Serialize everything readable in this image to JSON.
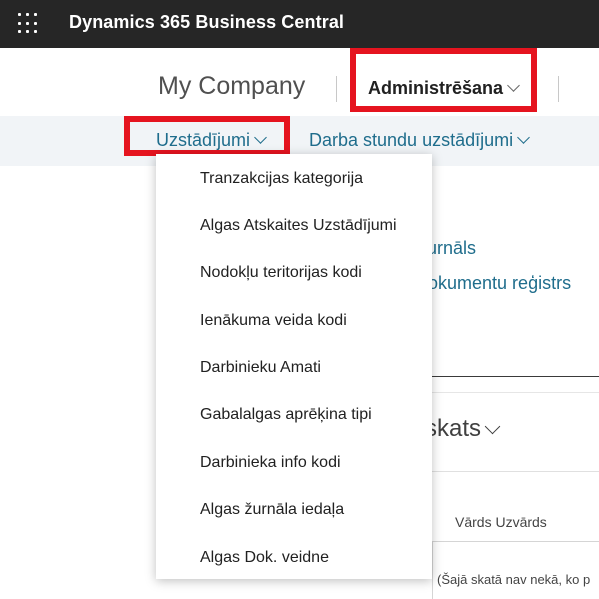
{
  "topbar": {
    "app_title": "Dynamics 365 Business Central"
  },
  "role_center": {
    "company": "My Company",
    "admin_menu": "Administrēšana"
  },
  "nav": {
    "setup_menu": "Uzstādījumi",
    "work_hours_menu": "Darba stundu uzstādījumi"
  },
  "background": {
    "link1": "žurnāls",
    "link2": "dokumentu reģistrs",
    "view_title": "skats",
    "column_header": "Vārds Uzvārds",
    "empty_message": "(Šajā skatā nav nekā, ko p"
  },
  "setup_dropdown": {
    "items": [
      "Tranzakcijas kategorija",
      "Algas Atskaites Uzstādījumi",
      "Nodokļu teritorijas kodi",
      "Ienākuma veida kodi",
      "Darbinieku Amati",
      "Gabalalgas aprēķina tipi",
      "Darbinieka info kodi",
      "Algas žurnāla iedaļa",
      "Algas Dok. veidne"
    ]
  },
  "colors": {
    "highlight": "#e5141f",
    "link": "#1f6d8c",
    "topbar": "#262626"
  },
  "icons": [
    "app-launcher-icon",
    "chevron-down-icon"
  ]
}
